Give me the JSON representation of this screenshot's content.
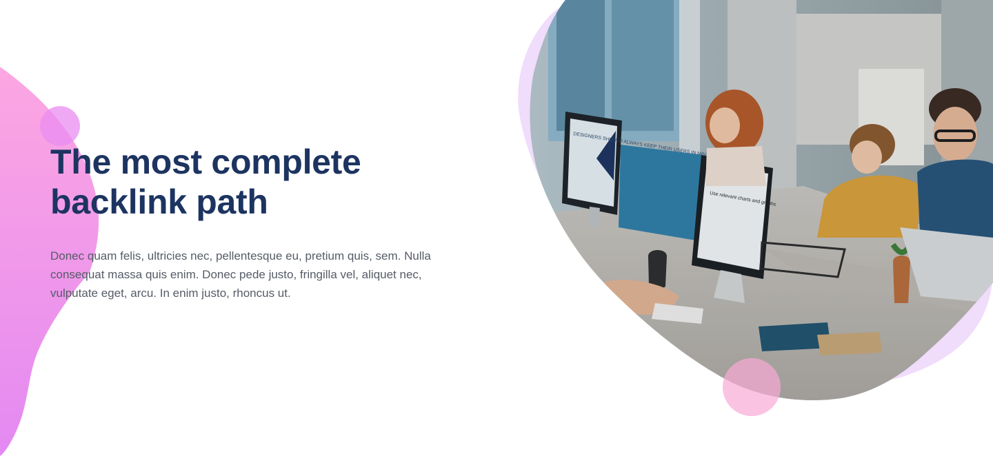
{
  "hero": {
    "title": "The most complete backlink path",
    "body": "Donec quam felis, ultricies nec, pellentesque eu, pretium quis, sem. Nulla consequat massa quis enim. Donec pede justo, fringilla vel, aliquet nec, vulputate eget, arcu. In enim justo, rhoncus ut."
  },
  "photo": {
    "monitor_left_text": "DESIGNERS SHOULD ALWAYS KEEP THEIR USERS IN MIND.",
    "monitor_right_text": "Use relevant charts and graphs"
  },
  "colors": {
    "heading": "#1d3461",
    "body_text": "#555b66",
    "blob_pink": "#f9a8e0",
    "blob_violet": "#e48cf2",
    "lavender": "#f0dcfb",
    "circle_pink": "#f9aad6"
  }
}
